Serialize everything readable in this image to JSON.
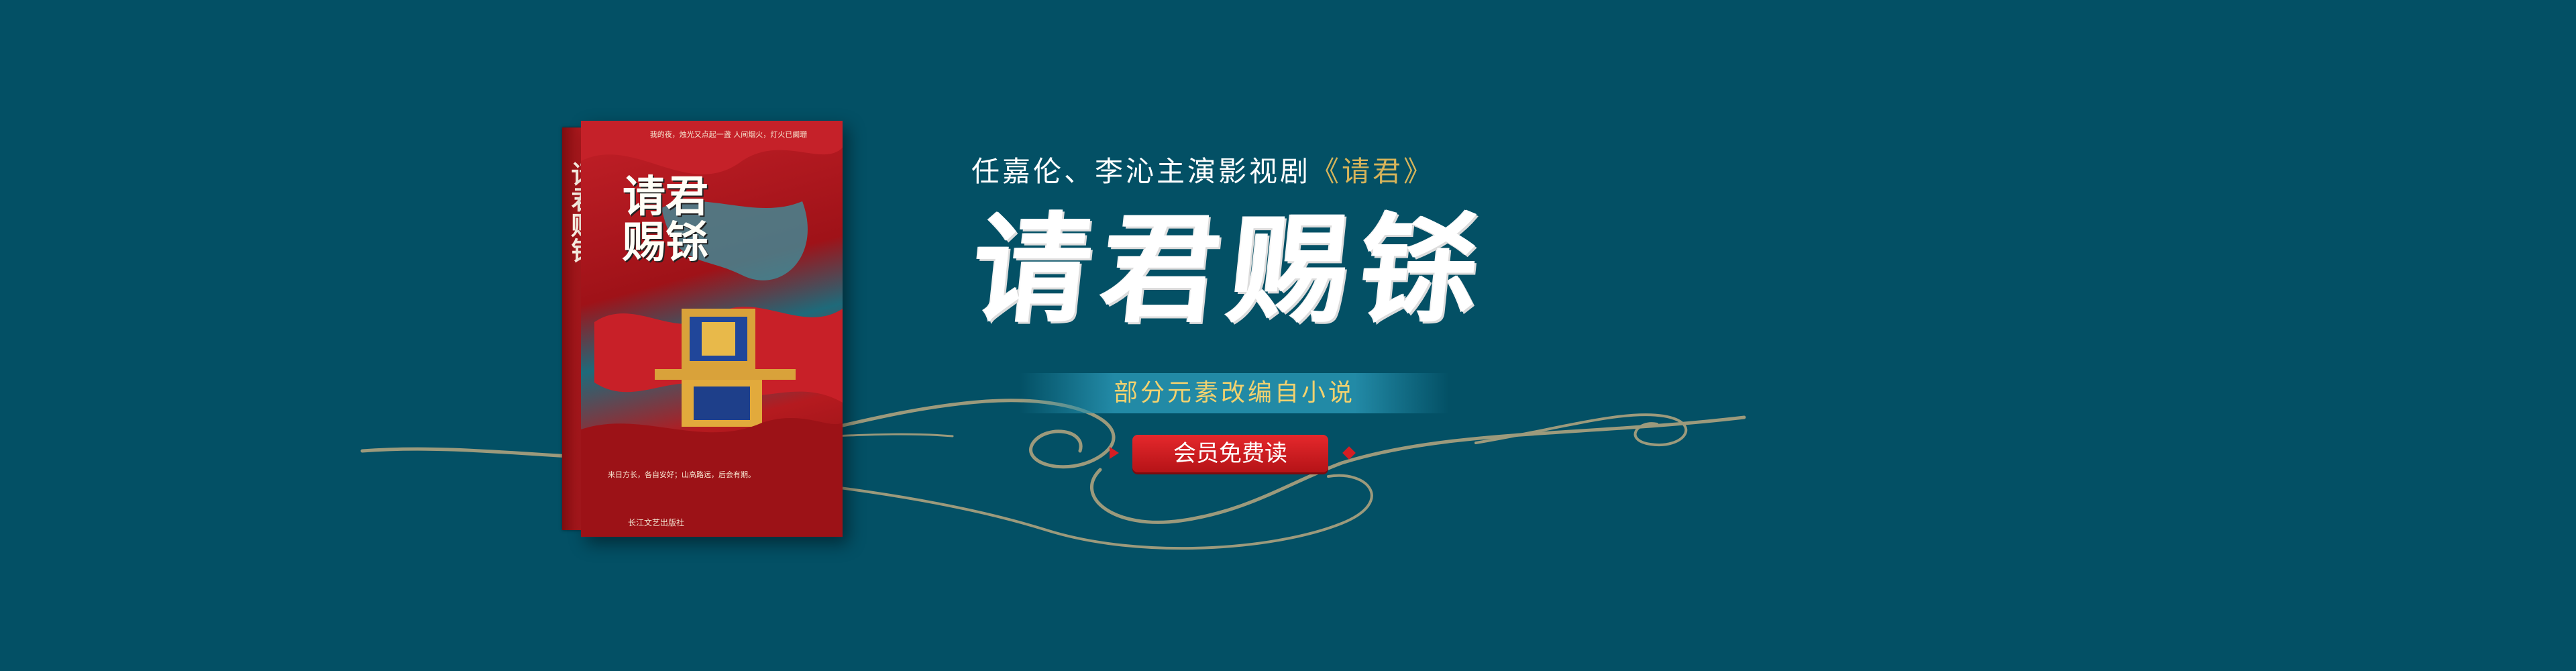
{
  "colors": {
    "background": "#035065",
    "accent_gold": "#d6b45a",
    "cta_red": "#d61e23",
    "ribbon_blue": "#248daa",
    "cloud_line": "#9c9a7c"
  },
  "headline": {
    "prefix": "任嘉伦、李沁主演影视剧",
    "drama_title": "《请君》"
  },
  "calligraphy_title": "请君赐铩",
  "ribbon_text": "部分元素改编自小说",
  "cta_label": "会员免费读",
  "book": {
    "cover_title": "请君赐铩",
    "spine_title": "请君赐铩",
    "top_text": "我的夜，烛光又点起一盏 人间烟火，灯火已阑珊",
    "bottom_text": "来日方长，各自安好；山高路远，后会有期。",
    "publisher": "长江文艺出版社"
  },
  "icons": {
    "cta_left": "triangle-arrow-icon",
    "cta_right": "diamond-icon"
  }
}
